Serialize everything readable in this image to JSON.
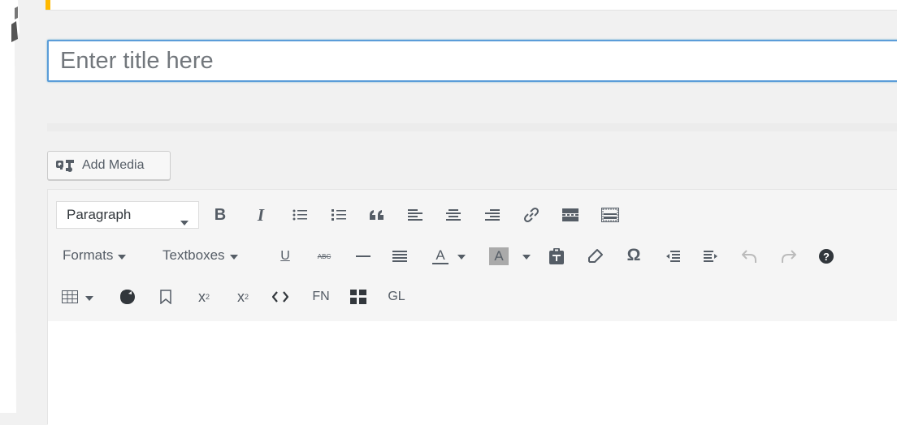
{
  "title_field": {
    "placeholder": "Enter title here",
    "value": ""
  },
  "media": {
    "add_media_label": "Add Media",
    "icon": "media-icon"
  },
  "toolbar": {
    "row1": {
      "format_select": {
        "value": "Paragraph"
      },
      "buttons": [
        "bold-icon",
        "italic-icon",
        "bulleted-list-icon",
        "numbered-list-icon",
        "blockquote-icon",
        "align-left-icon",
        "align-center-icon",
        "align-right-icon",
        "link-icon",
        "insert-more-icon",
        "toolbar-toggle-icon"
      ]
    },
    "row2": {
      "formats_label": "Formats",
      "textboxes_label": "Textboxes",
      "buttons": [
        "underline-icon",
        "strikethrough-icon",
        "horizontal-line-icon",
        "justify-icon",
        "text-color-icon",
        "background-color-icon",
        "paste-text-icon",
        "clear-formatting-icon",
        "special-character-icon",
        "outdent-icon",
        "indent-icon",
        "undo-icon",
        "redo-icon",
        "help-icon"
      ]
    },
    "row3": {
      "buttons": [
        "table-icon",
        "theme-icon",
        "bookmark-icon",
        "superscript-icon",
        "subscript-icon",
        "code-icon",
        "footnote-button",
        "grid-icon",
        "glossary-button"
      ],
      "fn_label": "FN",
      "gl_label": "GL",
      "strike_label": "ABC",
      "text_color_label": "A",
      "bg_color_label": "A",
      "underline_label": "U",
      "bold_label": "B",
      "italic_label": "I",
      "omega_label": "Ω",
      "superscript_label": "x",
      "subscript_label": "x"
    }
  },
  "colors": {
    "accent": "#ffb900",
    "focus": "#5b9dd9",
    "icon": "#555d66"
  }
}
